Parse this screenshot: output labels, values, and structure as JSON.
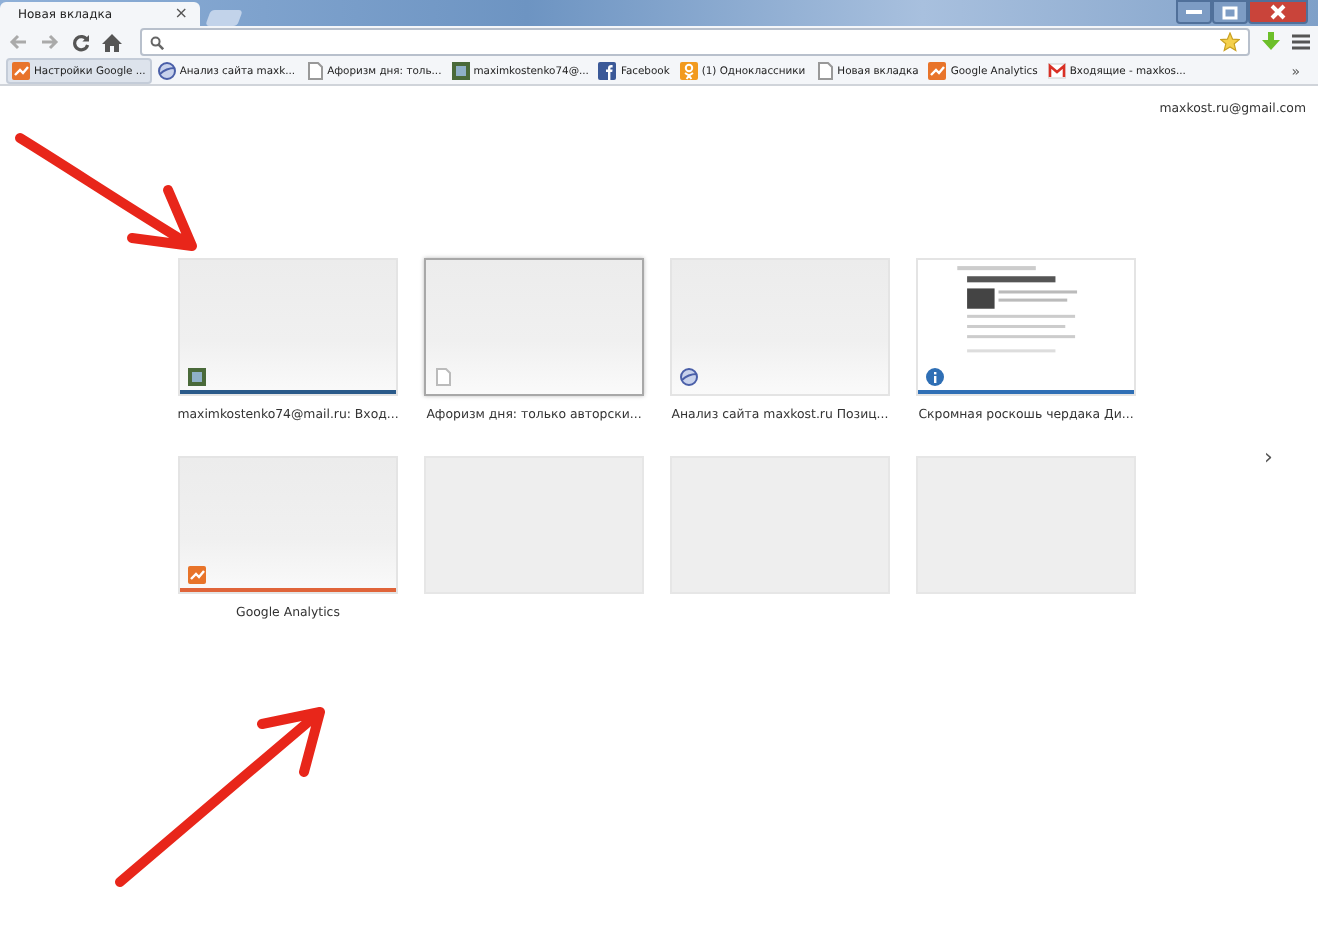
{
  "window": {
    "tab_title": "Новая вкладка",
    "tab_close": "×"
  },
  "bookmarks": [
    {
      "label": "Настройки Google ..."
    },
    {
      "label": "Анализ сайта maxk..."
    },
    {
      "label": "Афоризм дня: толь..."
    },
    {
      "label": "maximkostenko74@..."
    },
    {
      "label": "Facebook"
    },
    {
      "label": "(1) Одноклассники"
    },
    {
      "label": "Новая вкладка"
    },
    {
      "label": "Google Analytics"
    },
    {
      "label": "Входящие - maxkos..."
    }
  ],
  "bookmarks_more": "»",
  "account": "maxkost.ru@gmail.com",
  "tiles": [
    {
      "kind": "site",
      "title": "maximkostenko74@mail.ru: Вход...",
      "color": "#2a5a8a",
      "highlighted": false
    },
    {
      "kind": "site",
      "title": "Афоризм дня: только авторски...",
      "highlighted": true
    },
    {
      "kind": "site",
      "title": "Анализ сайта maxkost.ru Позиц...",
      "highlighted": false
    },
    {
      "kind": "site",
      "title": "Скромная роскошь чердака Ди...",
      "color": "#2f6fb5",
      "highlighted": false,
      "preview": true
    },
    {
      "kind": "site",
      "title": "Google Analytics",
      "color": "#e0643a",
      "highlighted": false
    },
    {
      "kind": "empty"
    },
    {
      "kind": "empty"
    },
    {
      "kind": "empty"
    }
  ],
  "next_page": "›"
}
